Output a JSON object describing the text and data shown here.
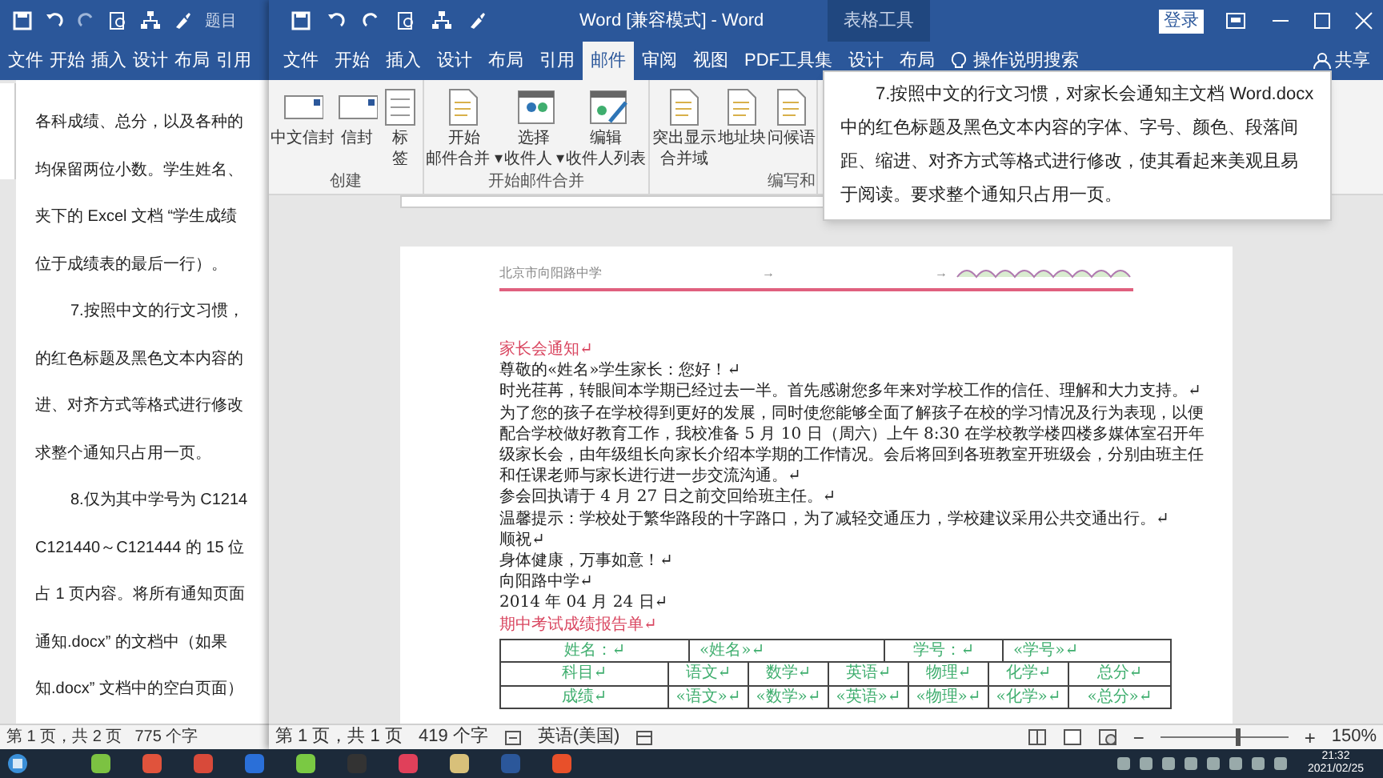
{
  "back_window": {
    "title": "题目",
    "tabs": [
      "文件",
      "开始",
      "插入",
      "设计",
      "布局",
      "引用"
    ],
    "lines": [
      {
        "text": "各科成绩、总分，以及各种的",
        "indent": false
      },
      {
        "text": "均保留两位小数。学生姓名、",
        "indent": false
      },
      {
        "text": "夹下的 Excel 文档 “学生成绩",
        "indent": false
      },
      {
        "text": "位于成绩表的最后一行）。",
        "indent": false
      },
      {
        "text": "7.按照中文的行文习惯，",
        "indent": true
      },
      {
        "text": "的红色标题及黑色文本内容的",
        "indent": false
      },
      {
        "text": "进、对齐方式等格式进行修改",
        "indent": false
      },
      {
        "text": "求整个通知只占用一页。",
        "indent": false
      },
      {
        "text": "8.仅为其中学号为 C1214",
        "indent": true
      },
      {
        "text": "C121440～C121444 的 15 位",
        "indent": false
      },
      {
        "text": "占 1 页内容。将所有通知页面",
        "indent": false
      },
      {
        "text": "通知.docx” 的文档中（如果",
        "indent": false
      },
      {
        "text": "知.docx” 文档中的空白页面）",
        "indent": false
      }
    ],
    "status_bar": {
      "page": "第 1 页，共 2 页",
      "words": "775 个字"
    }
  },
  "front_window": {
    "title": "Word [兼容模式] - Word",
    "context_group": "表格工具",
    "sign_in": "登录",
    "share": "共享",
    "tell_me": "操作说明搜索",
    "tabs": [
      {
        "label": "文件",
        "selected": false
      },
      {
        "label": "开始",
        "selected": false
      },
      {
        "label": "插入",
        "selected": false
      },
      {
        "label": "设计",
        "selected": false
      },
      {
        "label": "布局",
        "selected": false
      },
      {
        "label": "引用",
        "selected": false
      },
      {
        "label": "邮件",
        "selected": true
      },
      {
        "label": "审阅",
        "selected": false
      },
      {
        "label": "视图",
        "selected": false
      },
      {
        "label": "PDF工具集",
        "selected": false
      },
      {
        "label": "设计",
        "selected": false
      },
      {
        "label": "布局",
        "selected": false
      }
    ],
    "ribbon_groups": [
      {
        "label": "创建",
        "buttons": [
          {
            "lines": [
              "中文信封"
            ],
            "kind": "envelope"
          },
          {
            "lines": [
              "信封"
            ],
            "kind": "envelope"
          },
          {
            "lines": [
              "标",
              "签"
            ],
            "kind": "labels"
          }
        ]
      },
      {
        "label": "开始邮件合并",
        "buttons": [
          {
            "lines": [
              "开始",
              "邮件合并 ▾"
            ],
            "kind": "doc"
          },
          {
            "lines": [
              "选择",
              "收件人 ▾"
            ],
            "kind": "people"
          },
          {
            "lines": [
              "编辑",
              "收件人列表"
            ],
            "kind": "edit"
          }
        ]
      },
      {
        "label": "编写和",
        "buttons": [
          {
            "lines": [
              "突出显示",
              "合并域"
            ],
            "kind": "doc"
          },
          {
            "lines": [
              "地址块"
            ],
            "kind": "doc"
          },
          {
            "lines": [
              "问候语"
            ],
            "kind": "doc"
          }
        ]
      }
    ],
    "document": {
      "header": "北京市向阳路中学",
      "header_marks": [
        "→",
        "→"
      ],
      "paragraphs": [
        {
          "kind": "title",
          "text": "家长会通知↵"
        },
        {
          "kind": "body",
          "text": "尊敬的«姓名»学生家长：您好！↵"
        },
        {
          "kind": "body",
          "text": "时光荏苒，转眼间本学期已经过去一半。首先感谢您多年来对学校工作的信任、理解和大力支持。↵"
        },
        {
          "kind": "body",
          "text": "为了您的孩子在学校得到更好的发展，同时使您能够全面了解孩子在校的学习情况及行为表现，以便配合学校做好教育工作，我校准备 5 月 10 日（周六）上午 8:30 在学校教学楼四楼多媒体室召开年级家长会，由年级组长向家长介绍本学期的工作情况。会后将回到各班教室开班级会，分别由班主任和任课老师与家长进行进一步交流沟通。↵"
        },
        {
          "kind": "body",
          "text": "参会回执请于 4 月 27 日之前交回给班主任。↵"
        },
        {
          "kind": "body",
          "text": "温馨提示：学校处于繁华路段的十字路口，为了减轻交通压力，学校建议采用公共交通出行。↵"
        },
        {
          "kind": "body",
          "text": "顺祝↵"
        },
        {
          "kind": "body",
          "text": "身体健康，万事如意！↵"
        },
        {
          "kind": "body",
          "text": "向阳路中学↵"
        },
        {
          "kind": "body",
          "text": "2014 年 04 月 24 日↵"
        },
        {
          "kind": "title",
          "text": "期中考试成绩报告单↵"
        }
      ],
      "student_row": [
        "姓名：↵",
        "«姓名»↵",
        "学号：↵",
        "«学号»↵"
      ],
      "table": {
        "rows": [
          [
            "科目↵",
            "语文↵",
            "数学↵",
            "英语↵",
            "物理↵",
            "化学↵",
            "总分↵"
          ],
          [
            "成绩↵",
            "«语文»↵",
            "«数学»↵",
            "«英语»↵",
            "«物理»↵",
            "«化学»↵",
            "«总分»↵"
          ]
        ]
      }
    },
    "status_bar": {
      "page": "第 1 页，共 1 页",
      "words": "419 个字",
      "language": "英语(美国)",
      "zoom_out": "−",
      "zoom_in": "+",
      "zoom": "150%",
      "zoom_slider": {
        "level": 0.6
      }
    }
  },
  "tooltip": {
    "text": "7.按照中文的行文习惯，对家长会通知主文档 Word.docx 中的红色标题及黑色文本内容的字体、字号、颜色、段落间距、缩进、对齐方式等格式进行修改，使其看起来美观且易于阅读。要求整个通知只占用一页。"
  },
  "taskbar": {
    "time": "21:32",
    "date": "2021/02/25"
  }
}
